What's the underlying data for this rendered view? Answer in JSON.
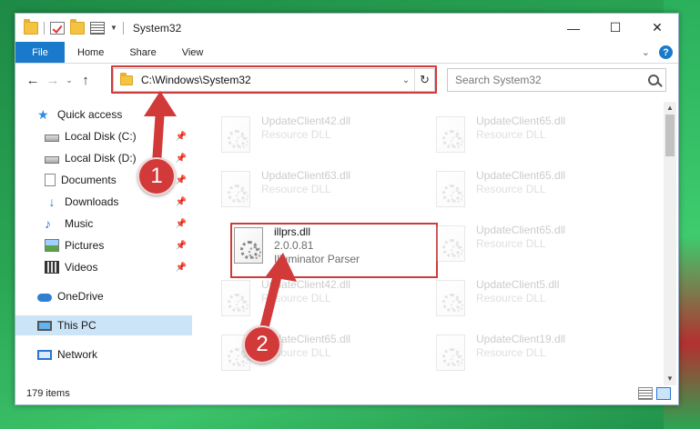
{
  "window": {
    "title": "System32",
    "controls": {
      "minimize": "—",
      "maximize": "☐",
      "close": "✕"
    }
  },
  "ribbon": {
    "tabs": [
      "File",
      "Home",
      "Share",
      "View"
    ],
    "help": "?"
  },
  "address_bar": {
    "path": "C:\\Windows\\System32"
  },
  "search": {
    "placeholder": "Search System32"
  },
  "nav_pane": {
    "items": [
      {
        "label": "Quick access",
        "icon": "star-icon"
      },
      {
        "label": "Local Disk (C:)",
        "icon": "drive-icon",
        "pinned": true
      },
      {
        "label": "Local Disk (D:)",
        "icon": "drive-icon",
        "pinned": true
      },
      {
        "label": "Documents",
        "icon": "document-icon",
        "pinned": true
      },
      {
        "label": "Downloads",
        "icon": "download-icon",
        "pinned": true
      },
      {
        "label": "Music",
        "icon": "music-icon",
        "pinned": true
      },
      {
        "label": "Pictures",
        "icon": "picture-icon",
        "pinned": true
      },
      {
        "label": "Videos",
        "icon": "video-icon",
        "pinned": true
      },
      {
        "label": "OneDrive",
        "icon": "cloud-icon"
      },
      {
        "label": "This PC",
        "icon": "computer-icon",
        "selected": true
      },
      {
        "label": "Network",
        "icon": "network-icon"
      }
    ]
  },
  "files": [
    {
      "name": "UpdateClient42.dll",
      "desc": "Resource DLL",
      "faded": true
    },
    {
      "name": "UpdateClient65.dll",
      "desc": "Resource DLL",
      "faded": true
    },
    {
      "name": "UpdateClient63.dll",
      "desc": "Resource DLL",
      "faded": true
    },
    {
      "name": "UpdateClient65.dll",
      "desc": "Resource DLL",
      "faded": true
    },
    {
      "name": "illprs.dll",
      "version": "2.0.0.81",
      "desc": "Illuminator Parser",
      "faded": false
    },
    {
      "name": "UpdateClient65.dll",
      "desc": "Resource DLL",
      "faded": true
    },
    {
      "name": "UpdateClient42.dll",
      "desc": "Resource DLL",
      "faded": true
    },
    {
      "name": "UpdateClient5.dll",
      "desc": "Resource DLL",
      "faded": true
    },
    {
      "name": "UpdateClient65.dll",
      "desc": "Resource DLL",
      "faded": true
    },
    {
      "name": "UpdateClient19.dll",
      "desc": "Resource DLL",
      "faded": true
    }
  ],
  "status": {
    "item_count": "179 items"
  },
  "annotations": [
    {
      "label": "1"
    },
    {
      "label": "2"
    }
  ],
  "colors": {
    "accent": "#1979ca",
    "highlight": "#d03a3a",
    "selected_bg": "#cce4f7"
  }
}
